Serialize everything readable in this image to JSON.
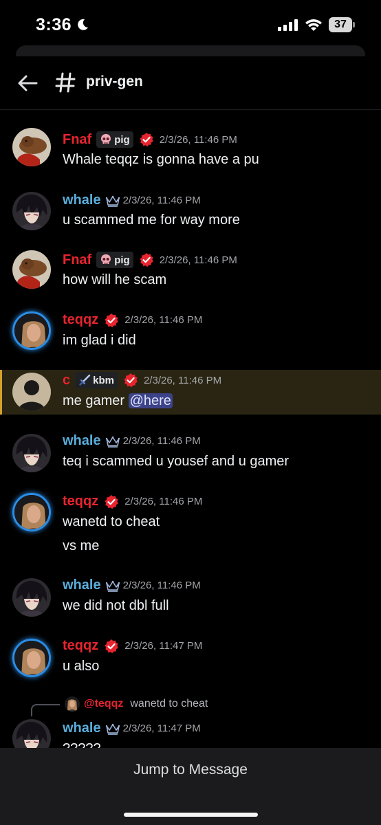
{
  "status_bar": {
    "time": "3:36",
    "battery": "37"
  },
  "header": {
    "channel": "priv-gen"
  },
  "messages": [
    {
      "author": "Fnaf",
      "tag": "pig",
      "timestamp": "2/3/26, 11:46 PM",
      "lines": [
        "Whale teqqz is gonna have a pu"
      ]
    },
    {
      "author": "whale",
      "timestamp": "2/3/26, 11:46 PM",
      "lines": [
        "u scammed me for way more"
      ]
    },
    {
      "author": "Fnaf",
      "tag": "pig",
      "timestamp": "2/3/26, 11:46 PM",
      "lines": [
        "how will he scam"
      ]
    },
    {
      "author": "teqqz",
      "timestamp": "2/3/26, 11:46 PM",
      "lines": [
        "im glad i did"
      ]
    },
    {
      "author": "c",
      "tag": "kbm",
      "timestamp": "2/3/26, 11:46 PM",
      "lines": [
        "me gamer"
      ],
      "mention": "@here"
    },
    {
      "author": "whale",
      "timestamp": "2/3/26, 11:46 PM",
      "lines": [
        "teq i scammed u yousef and u gamer"
      ]
    },
    {
      "author": "teqqz",
      "timestamp": "2/3/26, 11:46 PM",
      "lines": [
        "wanetd to cheat",
        "vs me"
      ]
    },
    {
      "author": "whale",
      "timestamp": "2/3/26, 11:46 PM",
      "lines": [
        "we did not dbl full"
      ]
    },
    {
      "author": "teqqz",
      "timestamp": "2/3/26, 11:47 PM",
      "lines": [
        "u also"
      ]
    },
    {
      "author": "whale",
      "timestamp": "2/3/26, 11:47 PM",
      "lines": [
        "?????"
      ],
      "reply": {
        "author": "@teqqz",
        "text": "wanetd to cheat"
      }
    }
  ],
  "bottom": {
    "jump_label": "Jump to Message"
  },
  "colors": {
    "red_name": "#e8242f",
    "blue_name": "#5aaedc",
    "highlight": "#2a2512",
    "mention_bg": "#3c4287"
  },
  "icons": [
    "moon-icon",
    "signal-icon",
    "wifi-icon",
    "battery-icon",
    "back-arrow-icon",
    "hash-icon",
    "verified-badge-icon",
    "crown-icon",
    "skull-icon",
    "sword-icon"
  ]
}
